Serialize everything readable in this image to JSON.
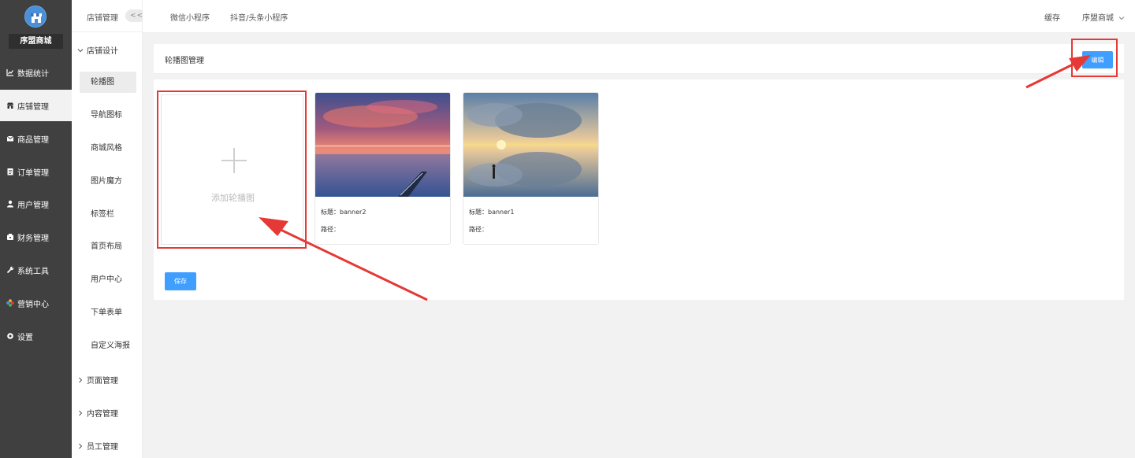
{
  "brand": {
    "name": "序盟商城"
  },
  "sidebar": {
    "items": [
      {
        "label": "数据统计",
        "icon": "chart-line-icon"
      },
      {
        "label": "店铺管理",
        "icon": "store-icon"
      },
      {
        "label": "商品管理",
        "icon": "mail-icon"
      },
      {
        "label": "订单管理",
        "icon": "document-icon"
      },
      {
        "label": "用户管理",
        "icon": "user-icon"
      },
      {
        "label": "财务管理",
        "icon": "wallet-icon"
      },
      {
        "label": "系统工具",
        "icon": "wrench-icon"
      },
      {
        "label": "营销中心",
        "icon": "marketing-icon"
      },
      {
        "label": "设置",
        "icon": "gear-icon"
      }
    ]
  },
  "subnav": {
    "title": "店铺管理",
    "collapse": "<<",
    "groups": [
      {
        "label": "店铺设计"
      },
      {
        "label": "页面管理"
      },
      {
        "label": "内容管理"
      },
      {
        "label": "员工管理"
      }
    ],
    "items": [
      {
        "label": "轮播图"
      },
      {
        "label": "导航图标"
      },
      {
        "label": "商城风格"
      },
      {
        "label": "图片魔方"
      },
      {
        "label": "标签栏"
      },
      {
        "label": "首页布局"
      },
      {
        "label": "用户中心"
      },
      {
        "label": "下单表单"
      },
      {
        "label": "自定义海报"
      }
    ]
  },
  "header": {
    "tabs": [
      {
        "label": "微信小程序"
      },
      {
        "label": "抖音/头条小程序"
      }
    ],
    "cache": "缓存",
    "store": "序盟商城"
  },
  "main": {
    "title": "轮播图管理",
    "edit_label": "编辑",
    "add_label": "添加轮播图",
    "save_label": "保存",
    "banners": [
      {
        "title": "标题：banner2",
        "path": "路径：",
        "image": "sunset-lake-boat"
      },
      {
        "title": "标题：banner1",
        "path": "路径：",
        "image": "cloud-reflection-person"
      }
    ]
  },
  "colors": {
    "accent": "#409eff",
    "sidebar": "#404040",
    "annotation": "#e53935"
  }
}
